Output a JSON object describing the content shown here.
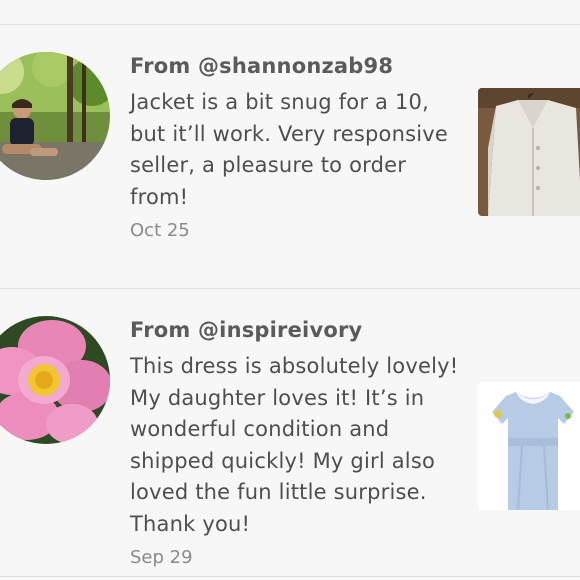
{
  "reviews": [
    {
      "from": "From @shannonzab98",
      "text": "Jacket is a bit snug for a 10, but it’ll work. Very responsive seller, a pleasure to order from!",
      "date": "Oct 25",
      "avatar": "hiker-avatar",
      "thumbnail": "white-jacket-photo"
    },
    {
      "from": "From @inspireivory",
      "text": "This dress is absolutely lovely! My daughter loves it! It’s in wonderful condition and shipped quickly! My girl also loved the fun little surprise. Thank you!",
      "date": "Sep 29",
      "avatar": "pink-flower-avatar",
      "thumbnail": "blue-dress-photo"
    }
  ]
}
